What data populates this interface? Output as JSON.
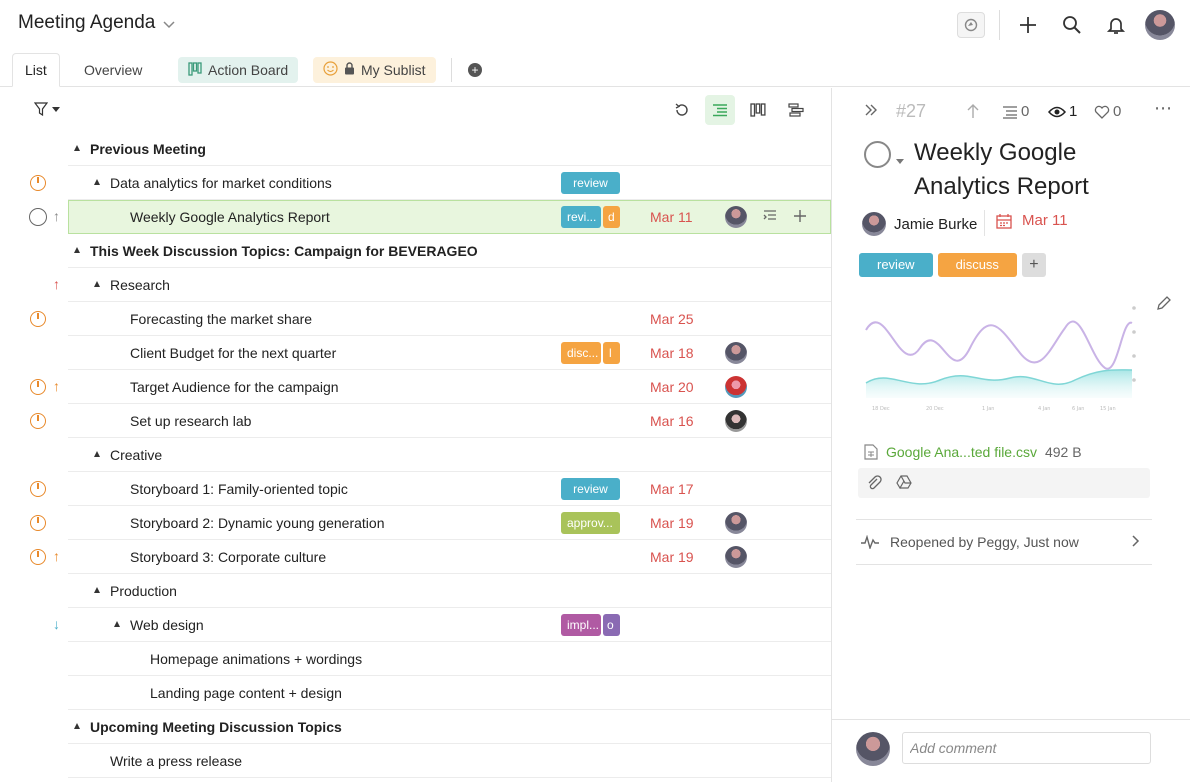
{
  "header": {
    "title": "Meeting Agenda"
  },
  "tabs": [
    {
      "label": "List"
    },
    {
      "label": "Overview"
    },
    {
      "label": "Action Board"
    },
    {
      "label": "My Sublist"
    }
  ],
  "rows": [
    {
      "label": "Previous Meeting"
    },
    {
      "label": "Data analytics for market conditions",
      "tag1": "review"
    },
    {
      "label": "Weekly Google Analytics Report",
      "tag1": "revi...",
      "tag2": "d",
      "date": "Mar 11"
    },
    {
      "label": "This Week Discussion Topics: Campaign for BEVERAGEO"
    },
    {
      "label": "Research"
    },
    {
      "label": "Forecasting the market share",
      "date": "Mar 25"
    },
    {
      "label": "Client Budget for the next quarter",
      "tag1": "disc...",
      "tag2": "l",
      "date": "Mar 18"
    },
    {
      "label": "Target Audience for the campaign",
      "date": "Mar 20"
    },
    {
      "label": "Set up research lab",
      "date": "Mar 16"
    },
    {
      "label": "Creative"
    },
    {
      "label": "Storyboard 1: Family-oriented topic",
      "tag1": "review",
      "date": "Mar 17"
    },
    {
      "label": "Storyboard 2: Dynamic young generation",
      "tag1": "approv...",
      "date": "Mar 19"
    },
    {
      "label": "Storyboard 3: Corporate culture",
      "date": "Mar 19"
    },
    {
      "label": "Production"
    },
    {
      "label": "Web design",
      "tag1": "impl...",
      "tag2": "o"
    },
    {
      "label": "Homepage animations + wordings"
    },
    {
      "label": "Landing page content + design"
    },
    {
      "label": "Upcoming Meeting Discussion Topics"
    },
    {
      "label": "Write a press release"
    }
  ],
  "panel": {
    "id": "#27",
    "subtasks": "0",
    "watchers": "1",
    "likes": "0",
    "title": "Weekly Google Analytics Report",
    "assignee": "Jamie Burke",
    "date": "Mar 11",
    "tags": [
      "review",
      "discuss"
    ],
    "chart_xlabels": [
      "18 Dec",
      "20 Dec",
      "1 Jan",
      "4 Jan",
      "6 Jan",
      "15 Jan"
    ],
    "attachment_name": "Google Ana...ted file.csv",
    "attachment_size": "492 B",
    "activity": "Reopened by Peggy, Just now",
    "comment_placeholder": "Add comment"
  },
  "colors": {
    "review": "#4aafc9",
    "discuss": "#f5a442",
    "approve": "#a9c35a",
    "implement": "#b05aa3",
    "implement_sq": "#8a6ab3",
    "date_red": "#d9534f",
    "selected_bg": "#e8f6de",
    "orange": "#e8892b",
    "green_link": "#5aa83a"
  }
}
